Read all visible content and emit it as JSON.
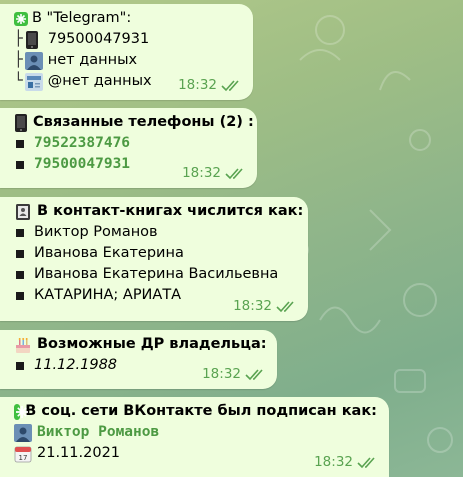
{
  "msg1": {
    "header": "В \"Telegram\":",
    "phone_prefix": "├",
    "phone": "79500047931",
    "name_prefix": "├",
    "name": "нет данных",
    "username_prefix": "└",
    "username": "@нет данных",
    "time": "18:32"
  },
  "msg2": {
    "title": "Связанные телефоны (2) :",
    "phones": [
      "79522387476",
      "79500047931"
    ],
    "time": "18:32"
  },
  "msg3": {
    "title": "В контакт-книгах числится как:",
    "names": [
      "Виктор Романов",
      "Иванова Екатерина",
      "Иванова Екатерина Васильевна",
      "КАТАРИНА; АРИАТА"
    ],
    "time": "18:32"
  },
  "msg4": {
    "title": "Возможные ДР владельца:",
    "date": "11.12.1988",
    "time": "18:32"
  },
  "msg5": {
    "title": "В соц. сети ВКонтакте был подписан как:",
    "name": "Виктор Романов",
    "date": "21.11.2021",
    "time": "18:32"
  },
  "icons": {
    "phone": "mobile-phone-icon",
    "user": "user-silhouette-icon",
    "id": "id-card-icon",
    "book": "address-book-icon",
    "cake": "birthday-cake-icon",
    "sparkle": "sparkle-icon",
    "calendar": "calendar-icon",
    "read": "double-check-icon"
  },
  "colors": {
    "bubble": "#effedd",
    "accent": "#4d9a43",
    "meta": "#5aa351"
  }
}
